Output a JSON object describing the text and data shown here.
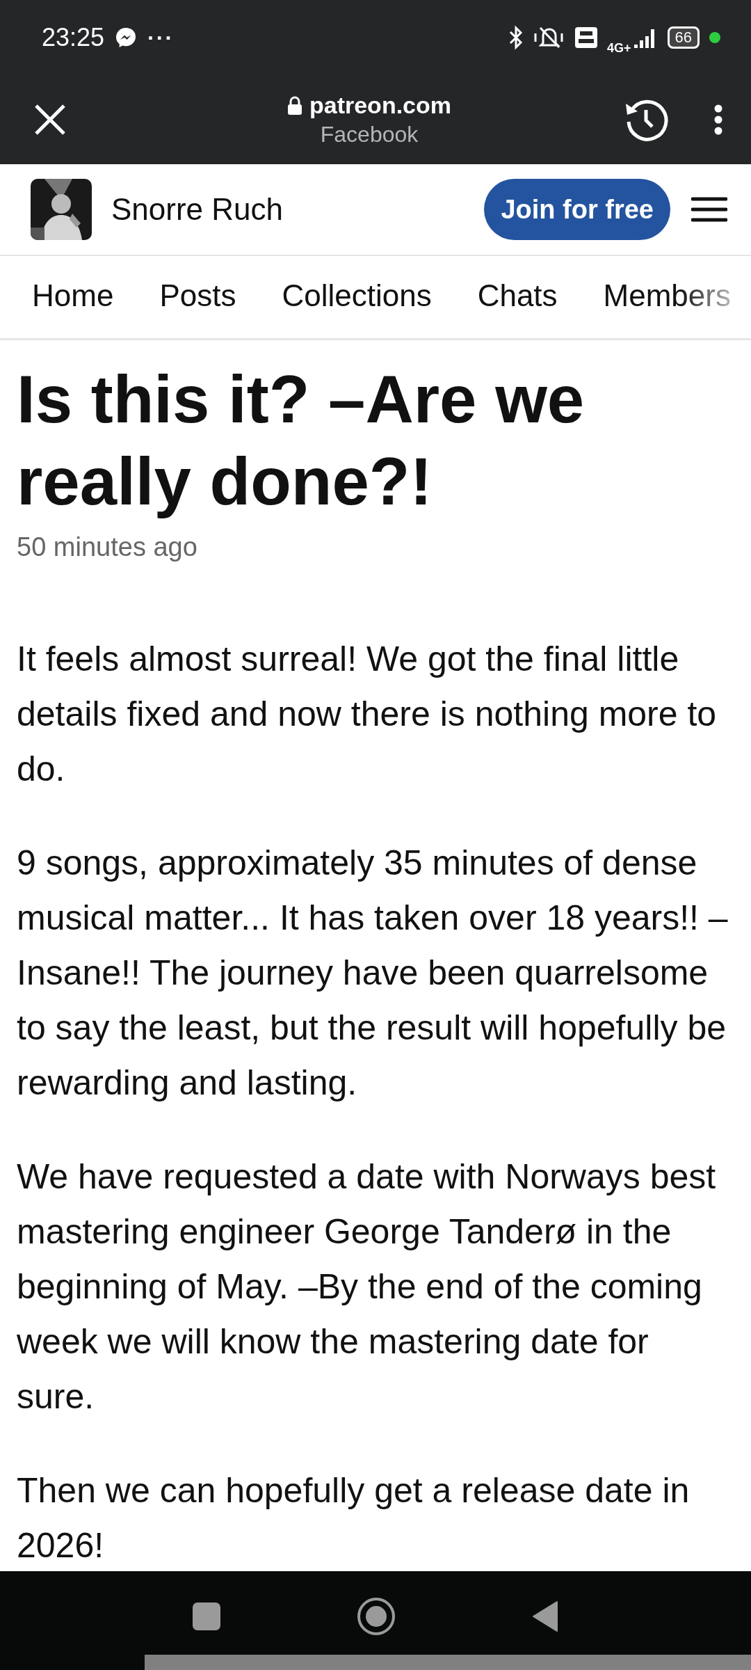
{
  "status_bar": {
    "time": "23:25",
    "more": "···",
    "battery": "66",
    "network": "4G+"
  },
  "browser": {
    "domain": "patreon.com",
    "source": "Facebook"
  },
  "header": {
    "creator": "Snorre Ruch",
    "join_button": "Join for free"
  },
  "tabs": [
    {
      "label": "Home",
      "selected": false
    },
    {
      "label": "Posts",
      "selected": false
    },
    {
      "label": "Collections",
      "selected": false
    },
    {
      "label": "Chats",
      "selected": false
    },
    {
      "label": "Members",
      "selected": false
    }
  ],
  "post": {
    "title": "Is this it? –Are we really done?!",
    "time": "50 minutes ago",
    "paragraphs": [
      "It feels almost surreal! We got the final little details fixed and now there is nothing more to do.",
      "9 songs, approximately 35 minutes of dense musical matter... It has taken over 18 years!! –Insane!! The journey have been quarrelsome to say the least, but the result will hopefully be rewarding and lasting.",
      "We have requested a date with Norways best mastering engineer George Tanderø in the beginning of May. –By the end of the coming week we will know the mastering date for sure.",
      "Then we can hopefully get a release date in 2026!"
    ]
  }
}
